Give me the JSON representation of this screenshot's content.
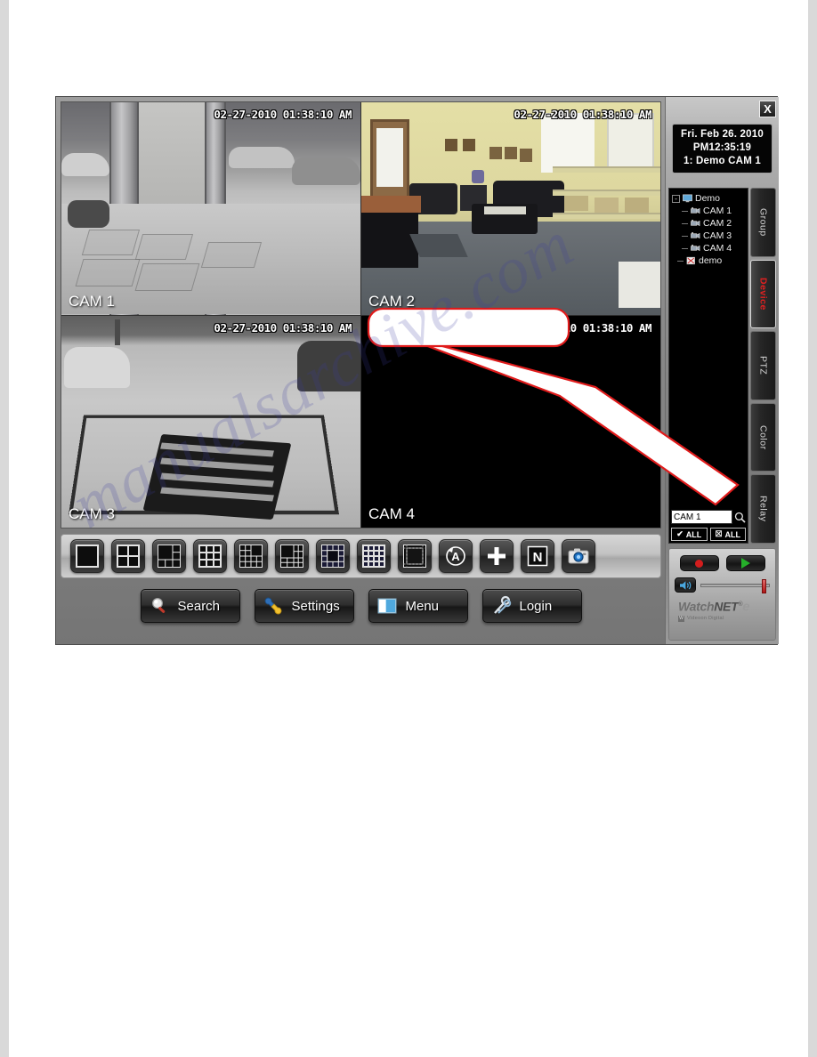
{
  "watermark": {
    "text": "manualsarchive.com"
  },
  "window": {
    "close_label": "X"
  },
  "clock": {
    "date": "Fri. Feb 26. 2010",
    "time": "PM12:35:19",
    "channel": "1: Demo CAM 1"
  },
  "cameras": [
    {
      "id": "cam1",
      "label": "CAM 1",
      "timestamp": "02-27-2010 01:38:10 AM",
      "selected": true,
      "scene": "snowy-entrance"
    },
    {
      "id": "cam2",
      "label": "CAM 2",
      "timestamp": "02-27-2010 01:38:10 AM",
      "selected": false,
      "scene": "office-lobby"
    },
    {
      "id": "cam3",
      "label": "CAM 3",
      "timestamp": "02-27-2010 01:38:10 AM",
      "selected": false,
      "scene": "snowy-parking"
    },
    {
      "id": "cam4",
      "label": "CAM 4",
      "timestamp": "02-27-2010 01:38:10 AM",
      "selected": false,
      "scene": "black"
    }
  ],
  "callout": {
    "text": ""
  },
  "layout_buttons": [
    {
      "name": "layout-1ch",
      "icon": "grid-1",
      "cols": 1,
      "rows": 1
    },
    {
      "name": "layout-4ch",
      "icon": "grid-4",
      "cols": 2,
      "rows": 2
    },
    {
      "name": "layout-6ch",
      "icon": "grid-6",
      "cols": 3,
      "rows": 3
    },
    {
      "name": "layout-9ch",
      "icon": "grid-9",
      "cols": 3,
      "rows": 3
    },
    {
      "name": "layout-8ch",
      "icon": "grid-8",
      "cols": 4,
      "rows": 4
    },
    {
      "name": "layout-10ch",
      "icon": "grid-10",
      "cols": 4,
      "rows": 4
    },
    {
      "name": "layout-13ch",
      "icon": "grid-13",
      "cols": 4,
      "rows": 4
    },
    {
      "name": "layout-16ch",
      "icon": "grid-16",
      "cols": 4,
      "rows": 4
    },
    {
      "name": "layout-full",
      "icon": "grid-full",
      "cols": 1,
      "rows": 1
    },
    {
      "name": "auto-sequence",
      "icon": "auto-rotate-icon",
      "glyph": "A"
    },
    {
      "name": "add-channel",
      "icon": "plus-icon",
      "glyph": "+"
    },
    {
      "name": "normal-mode",
      "icon": "letter-n-icon",
      "glyph": "N"
    },
    {
      "name": "snapshot",
      "icon": "camera-icon",
      "glyph": ""
    }
  ],
  "action_buttons": [
    {
      "name": "search-button",
      "label": "Search",
      "icon": "magnifier-icon"
    },
    {
      "name": "settings-button",
      "label": "Settings",
      "icon": "wrench-icon"
    },
    {
      "name": "menu-button",
      "label": "Menu",
      "icon": "window-icon"
    },
    {
      "name": "login-button",
      "label": "Login",
      "icon": "keys-icon"
    }
  ],
  "tree": {
    "root": {
      "label": "Demo",
      "icon": "monitor-icon",
      "expander": "-"
    },
    "children": [
      {
        "label": "CAM 1",
        "icon": "camera-icon"
      },
      {
        "label": "CAM 2",
        "icon": "camera-icon"
      },
      {
        "label": "CAM 3",
        "icon": "camera-icon"
      },
      {
        "label": "CAM 4",
        "icon": "camera-icon"
      }
    ],
    "extra": {
      "label": "demo",
      "icon": "broken-image-icon"
    }
  },
  "search": {
    "value": "CAM 1",
    "placeholder": "",
    "icon": "magnifier-icon",
    "check_all_label": "ALL",
    "uncheck_all_label": "ALL"
  },
  "tabs": [
    {
      "name": "tab-group",
      "label": "Group",
      "active": false
    },
    {
      "name": "tab-device",
      "label": "Device",
      "active": true
    },
    {
      "name": "tab-ptz",
      "label": "PTZ",
      "active": false
    },
    {
      "name": "tab-color",
      "label": "Color",
      "active": false
    },
    {
      "name": "tab-relay",
      "label": "Relay",
      "active": false
    }
  ],
  "deck": {
    "record_label": "",
    "play_label": "",
    "volume_icon": "speaker-icon",
    "volume_percent": 95
  },
  "brand": {
    "name_part1": "Watch",
    "name_part2": "NET",
    "trademark": "®",
    "suffix": "e",
    "tagline": "Videoon Digital"
  },
  "colors": {
    "accent_red": "#e02020",
    "selection_border": "#e2706a",
    "record_red": "#d31d1d",
    "play_green": "#25b02a",
    "panel_black": "#000000"
  }
}
